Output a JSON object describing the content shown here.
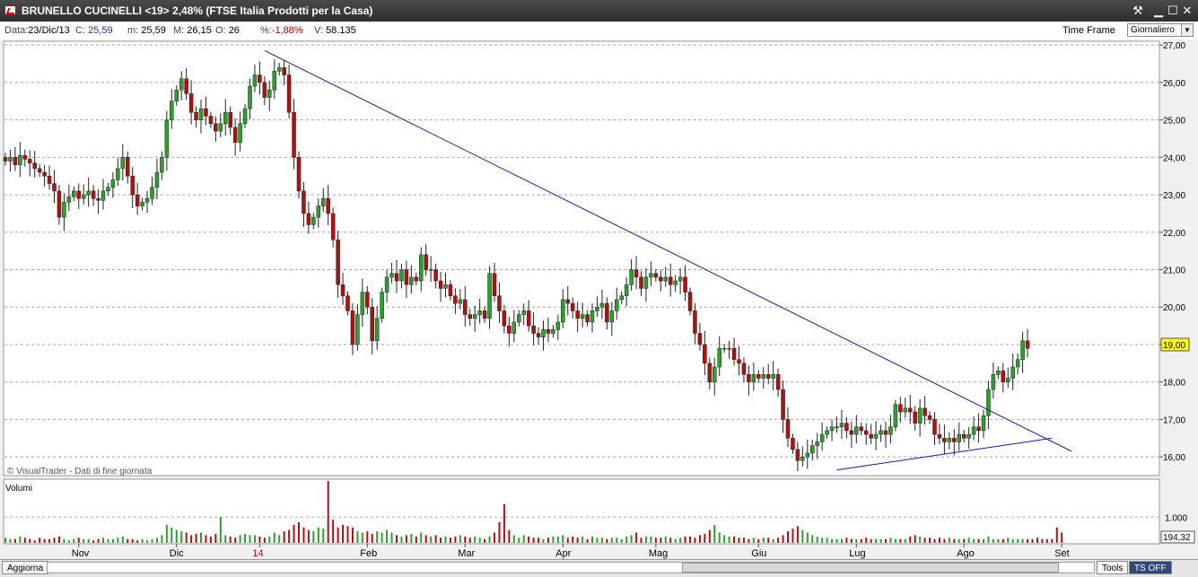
{
  "window": {
    "title": "BRUNELLO CUCINELLI <19> 2,48%  (FTSE Italia Prodotti per la Casa)",
    "controls": {
      "tool": "⚒",
      "minimize": "▁",
      "maximize": "☐",
      "close": "✕"
    }
  },
  "infobar": {
    "date_label": "Data:",
    "date_value": "23/Dic/13",
    "close_label": "C:",
    "close_value": "25,59",
    "min_label": "m:",
    "min_value": "25,59",
    "max_label": "M:",
    "max_value": "26,15",
    "open_label": "O:",
    "open_value": "26",
    "pct_label": "%:",
    "pct_value": "-1,88%",
    "vol_label": "V:",
    "vol_value": "58.135",
    "timeframe_label": "Time Frame",
    "timeframe_value": "Giornaliero"
  },
  "footer": {
    "credit": "© VisualTrader - Dati di fine giornata",
    "refresh_button": "Aggiorna",
    "tools_button": "Tools",
    "ts_button": "TS OFF"
  },
  "colors": {
    "up": "#2e9e2e",
    "down": "#b01010",
    "trendline": "#1a1aa0",
    "price_tag": "#ffff00",
    "grid": "#a8a8a8"
  },
  "chart_data": {
    "type": "candlestick",
    "price_axis": {
      "min": 15.5,
      "max": 27.1,
      "ticks": [
        "16,00",
        "17,00",
        "18,00",
        "19,00",
        "20,00",
        "21,00",
        "22,00",
        "23,00",
        "24,00",
        "25,00",
        "26,00",
        "27,00"
      ]
    },
    "last_price": "19,00",
    "volume_panel": {
      "label": "Volumi",
      "tick": "1.000",
      "last": "194,32"
    },
    "x_labels": [
      {
        "label": "Nov",
        "i": 15
      },
      {
        "label": "Dic",
        "i": 35
      },
      {
        "label": "14",
        "i": 52
      },
      {
        "label": "Feb",
        "i": 74
      },
      {
        "label": "Mar",
        "i": 94
      },
      {
        "label": "Apr",
        "i": 114
      },
      {
        "label": "Mag",
        "i": 133
      },
      {
        "label": "Giu",
        "i": 154
      },
      {
        "label": "Lug",
        "i": 174
      },
      {
        "label": "Ago",
        "i": 196
      },
      {
        "label": "Set",
        "i": 216
      }
    ],
    "close_series": [
      23.9,
      24.0,
      23.8,
      24.05,
      23.95,
      23.85,
      23.7,
      23.6,
      23.5,
      23.3,
      23.1,
      22.4,
      22.8,
      22.95,
      23.1,
      22.9,
      23.0,
      23.1,
      22.9,
      22.85,
      23.1,
      23.2,
      23.4,
      23.7,
      24.0,
      23.5,
      23.0,
      22.7,
      22.8,
      22.9,
      23.2,
      23.6,
      24.0,
      25.0,
      25.5,
      25.8,
      26.1,
      25.7,
      25.2,
      25.0,
      25.3,
      25.1,
      24.9,
      24.7,
      24.9,
      25.2,
      24.8,
      24.4,
      24.9,
      25.3,
      25.9,
      26.2,
      26.0,
      25.6,
      25.8,
      26.3,
      26.4,
      26.2,
      25.2,
      24.0,
      23.1,
      22.5,
      22.2,
      22.4,
      22.7,
      22.9,
      22.5,
      21.8,
      20.6,
      20.3,
      19.9,
      19.0,
      19.8,
      20.4,
      20.0,
      19.1,
      19.7,
      20.4,
      20.8,
      20.9,
      20.7,
      21.0,
      20.6,
      20.8,
      20.7,
      21.4,
      21.0,
      21.0,
      20.7,
      20.5,
      20.6,
      20.3,
      20.1,
      20.2,
      19.8,
      19.7,
      19.8,
      19.9,
      19.7,
      20.9,
      20.3,
      19.9,
      19.5,
      19.3,
      19.6,
      19.8,
      19.9,
      19.5,
      19.3,
      19.2,
      19.4,
      19.3,
      19.4,
      19.6,
      20.2,
      20.1,
      19.9,
      19.7,
      19.8,
      19.6,
      19.9,
      20.0,
      20.1,
      19.6,
      19.9,
      20.2,
      20.3,
      20.6,
      21.0,
      20.8,
      20.5,
      20.8,
      20.9,
      20.8,
      20.7,
      20.8,
      20.6,
      20.7,
      20.8,
      20.4,
      19.9,
      19.3,
      19.0,
      18.5,
      18.0,
      18.4,
      18.9,
      18.9,
      18.9,
      18.6,
      18.5,
      18.2,
      18.0,
      18.2,
      18.1,
      18.2,
      18.1,
      18.2,
      17.8,
      17.0,
      16.5,
      16.2,
      15.9,
      16.0,
      16.1,
      16.3,
      16.4,
      16.6,
      16.7,
      16.8,
      16.8,
      16.9,
      16.7,
      16.6,
      16.8,
      16.7,
      16.6,
      16.5,
      16.6,
      16.7,
      16.6,
      16.8,
      17.4,
      17.2,
      17.3,
      17.2,
      16.9,
      17.3,
      17.1,
      17.0,
      16.6,
      16.5,
      16.4,
      16.5,
      16.4,
      16.6,
      16.5,
      16.6,
      16.8,
      16.7,
      17.1,
      17.8,
      18.2,
      18.3,
      18.0,
      18.1,
      18.4,
      18.6,
      19.1,
      18.9
    ],
    "volume_series": [
      4,
      3,
      3,
      5,
      4,
      3,
      2,
      4,
      3,
      3,
      4,
      5,
      3,
      2,
      3,
      4,
      3,
      3,
      2,
      3,
      4,
      3,
      3,
      4,
      5,
      3,
      3,
      2,
      3,
      2,
      3,
      4,
      6,
      14,
      12,
      10,
      9,
      8,
      6,
      7,
      8,
      6,
      5,
      7,
      20,
      6,
      5,
      4,
      6,
      7,
      6,
      6,
      5,
      4,
      5,
      8,
      6,
      9,
      10,
      14,
      16,
      12,
      10,
      9,
      12,
      11,
      48,
      18,
      12,
      14,
      13,
      12,
      9,
      8,
      9,
      7,
      9,
      8,
      10,
      8,
      6,
      5,
      6,
      7,
      5,
      8,
      6,
      5,
      6,
      4,
      5,
      4,
      5,
      6,
      5,
      4,
      5,
      4,
      3,
      5,
      8,
      16,
      30,
      10,
      6,
      4,
      6,
      5,
      4,
      4,
      3,
      4,
      5,
      5,
      6,
      4,
      5,
      4,
      5,
      3,
      5,
      4,
      4,
      3,
      4,
      4,
      3,
      5,
      6,
      8,
      4,
      5,
      5,
      4,
      4,
      5,
      4,
      3,
      4,
      5,
      5,
      4,
      6,
      7,
      10,
      14,
      8,
      6,
      5,
      5,
      4,
      4,
      3,
      4,
      3,
      4,
      4,
      3,
      4,
      6,
      9,
      11,
      13,
      10,
      8,
      6,
      5,
      4,
      4,
      3,
      3,
      3,
      4,
      3,
      3,
      3,
      4,
      3,
      3,
      3,
      3,
      4,
      3,
      3,
      3,
      5,
      6,
      5,
      4,
      4,
      3,
      4,
      3,
      4,
      3,
      3,
      3,
      4,
      3,
      3,
      3,
      5,
      3,
      3,
      3,
      4,
      3,
      3,
      3,
      3,
      3,
      4,
      3,
      3,
      3,
      12,
      8
    ]
  }
}
